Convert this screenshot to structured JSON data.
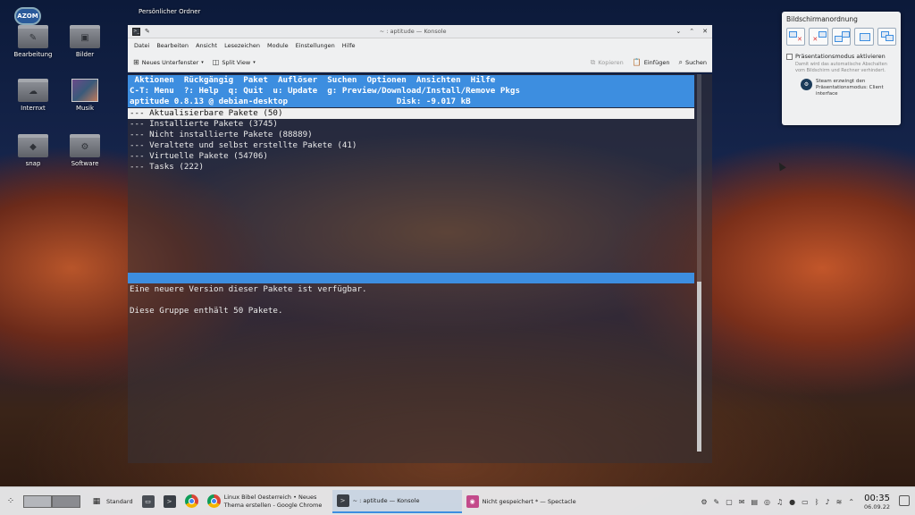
{
  "desktop": {
    "folder_header": "Persönlicher Ordner",
    "icons": [
      {
        "label": "Bearbeitung",
        "glyph": "✎"
      },
      {
        "label": "Bilder",
        "glyph": "▣"
      },
      {
        "label": "Internxt",
        "glyph": "☁"
      },
      {
        "label": "Musik",
        "glyph": "♪"
      },
      {
        "label": "snap",
        "glyph": "◆"
      },
      {
        "label": "Software",
        "glyph": "⚙"
      }
    ],
    "logo_text": "AZOM"
  },
  "konsole": {
    "title": "~ : aptitude — Konsole",
    "menu": [
      "Datei",
      "Bearbeiten",
      "Ansicht",
      "Lesezeichen",
      "Module",
      "Einstellungen",
      "Hilfe"
    ],
    "toolbar": {
      "new_tab": "Neues Unterfenster",
      "split_view": "Split View",
      "copy": "Kopieren",
      "paste": "Einfügen",
      "search": "Suchen"
    },
    "terminal": {
      "menu_line": " Aktionen  Rückgängig  Paket  Auflöser  Suchen  Optionen  Ansichten  Hilfe",
      "help_line": "C-T: Menu  ?: Help  q: Quit  u: Update  g: Preview/Download/Install/Remove Pkgs",
      "status_line": "aptitude 0.8.13 @ debian-desktop                      Disk: -9.017 kB",
      "selected_line": "--- Aktualisierbare Pakete (50)",
      "lines": [
        "--- Installierte Pakete (3745)",
        "--- Nicht installierte Pakete (88889)",
        "--- Veraltete und selbst erstellte Pakete (41)",
        "--- Virtuelle Pakete (54706)",
        "--- Tasks (222)"
      ],
      "desc_line1": "Eine neuere Version dieser Pakete ist verfügbar.",
      "desc_line2": "Diese Gruppe enthält 50 Pakete."
    }
  },
  "popup": {
    "title": "Bildschirmanordnung",
    "checkbox_label": "Präsentationsmodus aktivieren",
    "note": "Damit wird das automatische Abschalten vom Bildschirm und Rechner verhindert.",
    "steam_text": "Steam erzwingt den Präsentationsmodus: Client interface"
  },
  "taskbar": {
    "standard_label": "Standard",
    "chrome_task": "Linux Bibel Oesterreich • Neues Thema erstellen - Google Chrome",
    "konsole_task": "~ : aptitude — Konsole",
    "spectacle_task": "Nicht gespeichert * — Spectacle",
    "time": "00:35",
    "date": "06.09.22"
  },
  "colors": {
    "aptitude_highlight": "#3d8ee0",
    "accent": "#3d8ee0"
  }
}
